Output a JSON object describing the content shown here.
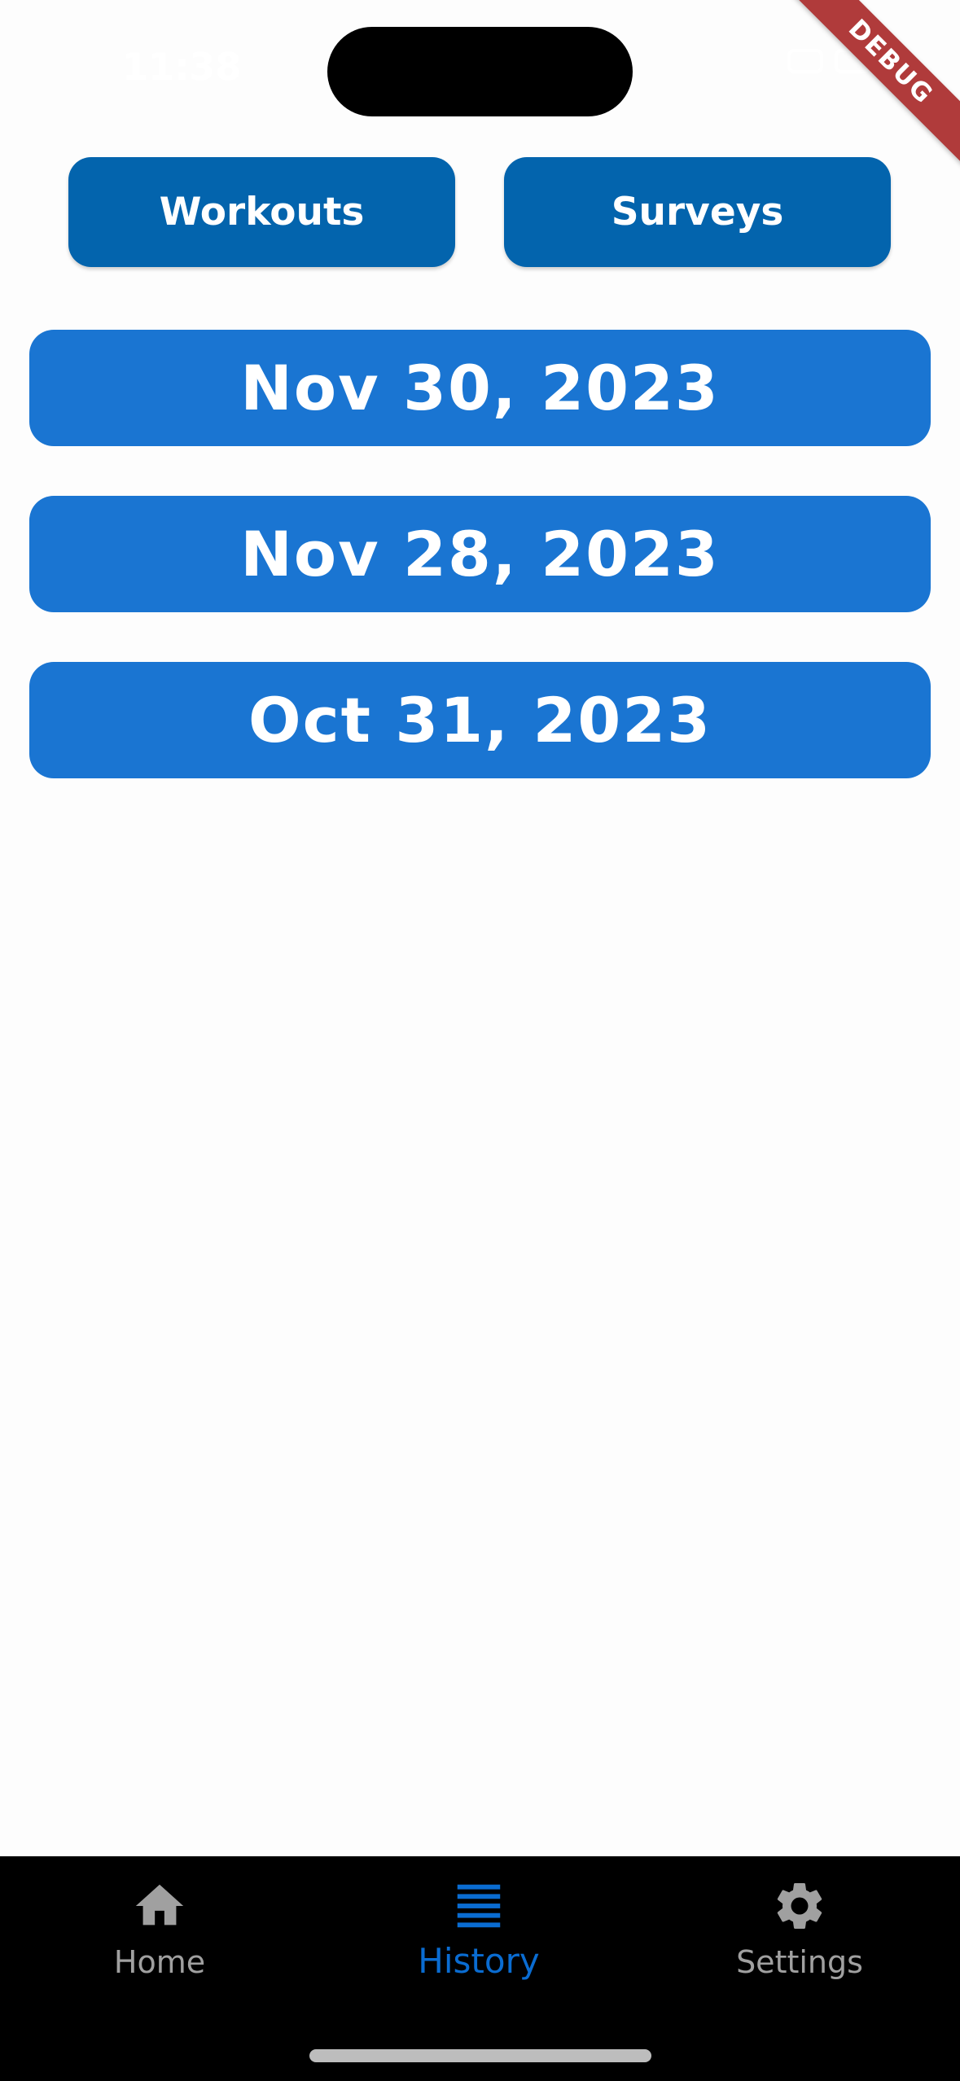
{
  "status_bar": {
    "time": "11:38"
  },
  "debug_banner": "DEBUG",
  "tabs": {
    "workouts_label": "Workouts",
    "surveys_label": "Surveys"
  },
  "history_dates": [
    "Nov 30, 2023",
    "Nov 28, 2023",
    "Oct 31, 2023"
  ],
  "bottom_nav": {
    "items": [
      {
        "label": "Home",
        "icon": "home-icon"
      },
      {
        "label": "History",
        "icon": "list-icon",
        "active": true
      },
      {
        "label": "Settings",
        "icon": "gear-icon"
      }
    ]
  },
  "colors": {
    "primary": "#1a75d2",
    "secondary_button": "#0364ad",
    "nav_active": "#0a6cd1",
    "nav_inactive": "#a0a0a0",
    "debug_ribbon": "#b03b3b"
  }
}
